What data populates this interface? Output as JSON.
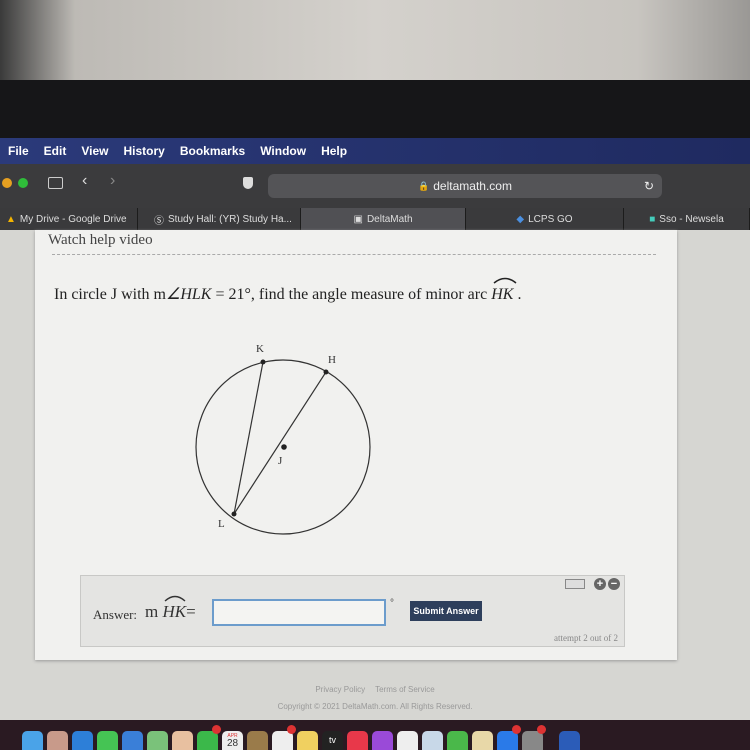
{
  "menubar": {
    "items": [
      "File",
      "Edit",
      "View",
      "History",
      "Bookmarks",
      "Window",
      "Help"
    ]
  },
  "browser": {
    "url": "deltamath.com"
  },
  "tabs": [
    {
      "label": "My Drive - Google Drive"
    },
    {
      "label": "Study Hall: (YR) Study Ha..."
    },
    {
      "label": "DeltaMath",
      "active": true
    },
    {
      "label": "LCPS GO"
    },
    {
      "label": "Sso - Newsela"
    }
  ],
  "page": {
    "help_link": "Watch help video",
    "question_prefix": "In circle J with m",
    "question_angle": "∠HLK",
    "question_eq": " = 21°",
    "question_mid": ", find the angle measure of minor arc ",
    "question_arc": "HK",
    "question_end": " .",
    "diagram": {
      "points": {
        "K": "K",
        "H": "H",
        "J": "J",
        "L": "L"
      },
      "given_angle_deg": 21
    },
    "answer": {
      "label": "Answer:",
      "math_prefix": "m ",
      "math_arc": "HK",
      "math_eq": "=",
      "value": "",
      "unit": "°",
      "submit": "Submit Answer",
      "attempt": "attempt 2 out of 2"
    },
    "footer": {
      "privacy": "Privacy Policy",
      "terms": "Terms of Service",
      "copyright": "Copyright © 2021 DeltaMath.com. All Rights Reserved."
    }
  },
  "dock": {
    "calendar_month": "APR",
    "calendar_day": "28",
    "tv_label": "tv"
  },
  "colors": {
    "submit": "#2e3f5c",
    "input_border": "#6c9ccc",
    "menubar": "#2b3a7a"
  }
}
